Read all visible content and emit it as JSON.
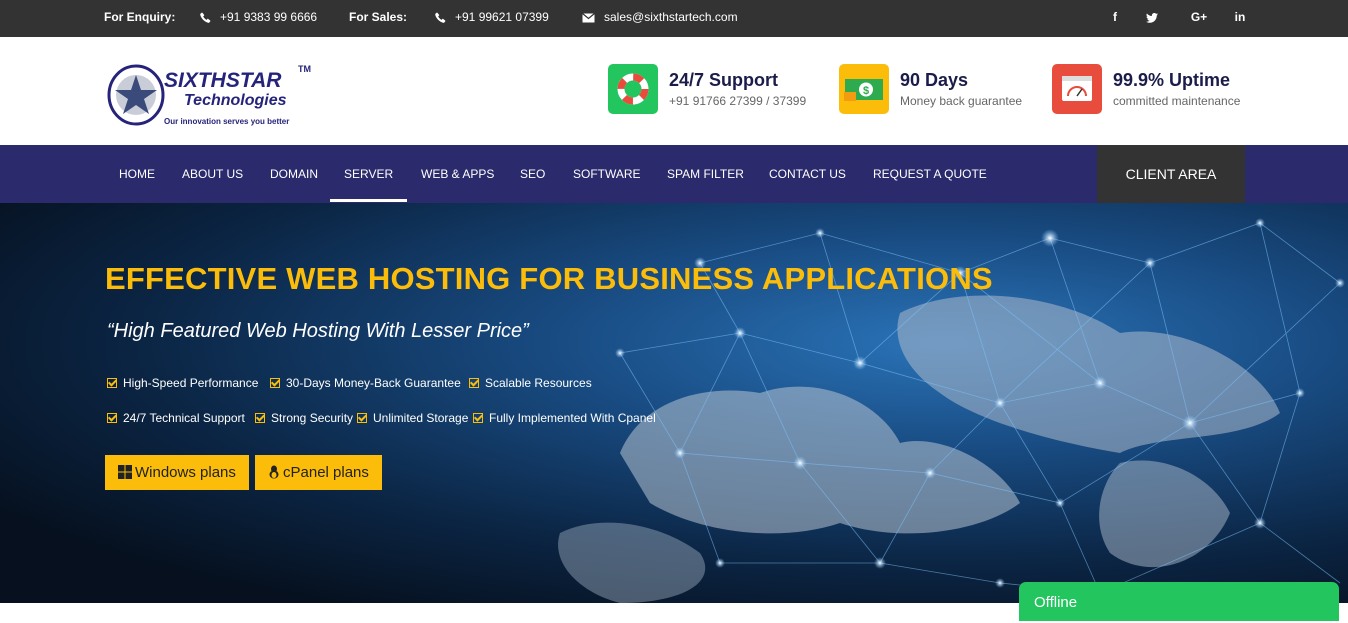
{
  "topbar": {
    "enquiry_label": "For Enquiry:",
    "enquiry_phone": "+91 9383 99 6666",
    "sales_label": "For Sales:",
    "sales_phone": "+91 99621 07399",
    "email": "sales@sixthstartech.com",
    "social": [
      "f",
      "t",
      "G+",
      "in"
    ]
  },
  "logo": {
    "name": "SIXTHSTAR",
    "tm": "TM",
    "sub": "Technologies",
    "tagline": "Our innovation serves you better"
  },
  "features": [
    {
      "title": "24/7 Support",
      "sub": "+91 91766 27399 / 37399",
      "color": "#22c55e",
      "icon": "lifebuoy-icon"
    },
    {
      "title": "90 Days",
      "sub": "Money back guarantee",
      "color": "#fbbd0a",
      "icon": "money-icon"
    },
    {
      "title": "99.9% Uptime",
      "sub": "committed maintenance",
      "color": "#e74c3c",
      "icon": "gauge-icon"
    }
  ],
  "nav": {
    "items": [
      "HOME",
      "ABOUT US",
      "DOMAIN",
      "SERVER",
      "WEB & APPS",
      "SEO",
      "SOFTWARE",
      "SPAM FILTER",
      "CONTACT US",
      "REQUEST A QUOTE"
    ],
    "active": "SERVER",
    "client_area": "CLIENT AREA"
  },
  "hero": {
    "title": "EFFECTIVE WEB HOSTING FOR BUSINESS APPLICATIONS",
    "tagline": "“High Featured Web Hosting With Lesser Price”",
    "bullets_row1": [
      "High-Speed Performance",
      "30-Days Money-Back Guarantee",
      "Scalable Resources"
    ],
    "bullets_row2": [
      "24/7 Technical Support",
      "Strong Security",
      "Unlimited Storage",
      "Fully Implemented With Cpanel"
    ],
    "windows_btn": "Windows plans",
    "cpanel_btn": "cPanel plans"
  },
  "chat": {
    "status": "Offline"
  },
  "colors": {
    "nav": "#2b2a6c",
    "accent": "#fbbd0a",
    "topbar": "#333333"
  }
}
